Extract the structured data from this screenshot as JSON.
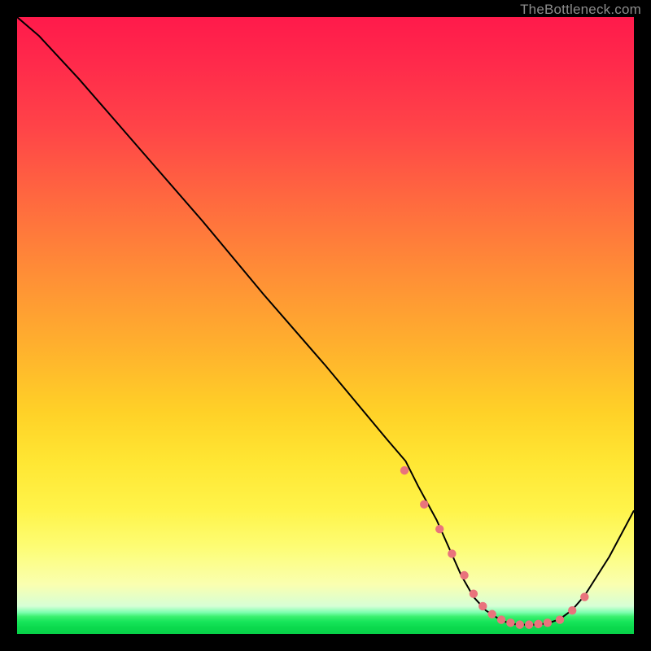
{
  "watermark": "TheBottleneck.com",
  "chart_data": {
    "type": "line",
    "title": "",
    "xlabel": "",
    "ylabel": "",
    "xlim": [
      0,
      100
    ],
    "ylim": [
      0,
      100
    ],
    "grid": false,
    "series": [
      {
        "name": "curve",
        "x": [
          0,
          3.5,
          10,
          20,
          30,
          40,
          50,
          60,
          63,
          65,
          68,
          70,
          72,
          74,
          76,
          78,
          80,
          82,
          84,
          86,
          88,
          90,
          92,
          96,
          100
        ],
        "y": [
          100,
          97,
          90,
          78.5,
          67,
          55,
          43.5,
          31.5,
          28,
          24,
          18.5,
          14,
          9.5,
          6,
          3.8,
          2.5,
          1.6,
          1.5,
          1.5,
          1.7,
          2.4,
          3.9,
          6.2,
          12.5,
          20
        ],
        "color": "#000000"
      }
    ],
    "markers": {
      "name": "valley-dots",
      "color": "#e9737c",
      "radius_px": 5.2,
      "x": [
        62.8,
        66,
        68.5,
        70.5,
        72.5,
        74,
        75.5,
        77,
        78.5,
        80,
        81.5,
        83,
        84.5,
        86,
        88,
        90,
        92
      ],
      "y": [
        26.5,
        21.0,
        17.0,
        13.0,
        9.5,
        6.5,
        4.5,
        3.2,
        2.3,
        1.8,
        1.5,
        1.5,
        1.6,
        1.8,
        2.3,
        3.8,
        6.0
      ]
    }
  }
}
